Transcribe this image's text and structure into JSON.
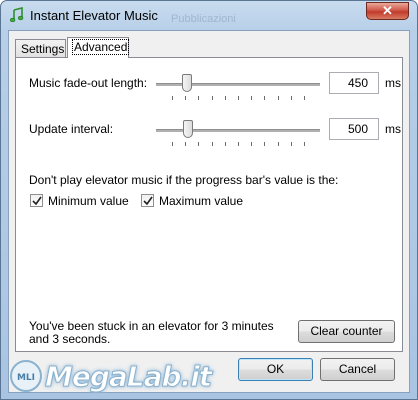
{
  "window": {
    "title": "Instant Elevator Music",
    "ghost_title": "Pubblicazioni",
    "close_glyph": "✕"
  },
  "tabs": [
    {
      "label": "Settings",
      "active": false
    },
    {
      "label": "Advanced",
      "active": true
    }
  ],
  "advanced": {
    "fade": {
      "label": "Music fade-out length:",
      "value": "450",
      "unit": "ms",
      "slider_fraction": 0.11
    },
    "update": {
      "label": "Update interval:",
      "value": "500",
      "unit": "ms",
      "slider_fraction": 0.12
    },
    "condition_label": "Don't play elevator music if the progress bar's value is the:",
    "min_checkbox": {
      "label": "Minimum value",
      "checked": true
    },
    "max_checkbox": {
      "label": "Maximum value",
      "checked": true
    },
    "stuck_text": "You've been stuck in an elevator for 3 minutes and 3 seconds.",
    "clear_button": "Clear counter"
  },
  "buttons": {
    "ok": "OK",
    "cancel": "Cancel"
  },
  "watermark": {
    "text": "MegaLab.it",
    "badge": "MLI"
  },
  "colors": {
    "accent": "#3c7fb1",
    "close": "#c23a2b",
    "frame": "#b7cfe8"
  }
}
